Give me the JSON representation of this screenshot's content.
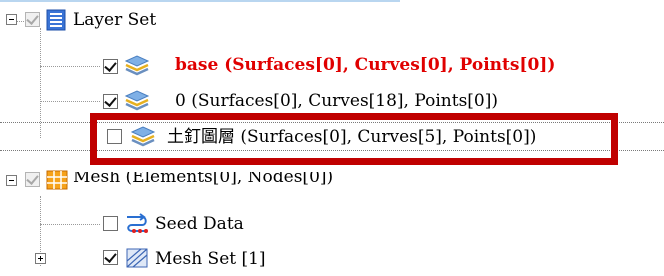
{
  "tree": {
    "layer_set": {
      "label": "Layer Set",
      "icon": "layer-set-icon",
      "checked": true
    },
    "layers": [
      {
        "label": "base (Surfaces[0], Curves[0], Points[0])",
        "checked": true,
        "active": true,
        "icon": "layers-stack-icon"
      },
      {
        "label": "0 (Surfaces[0], Curves[18], Points[0])",
        "checked": true,
        "active": false,
        "icon": "layers-stack-icon"
      },
      {
        "label": "土釘圖層 (Surfaces[0], Curves[5], Points[0])",
        "checked": false,
        "active": false,
        "icon": "layers-stack-icon"
      }
    ],
    "mesh": {
      "label": "Mesh (Elements[0], Nodes[0])",
      "icon": "mesh-grid-icon",
      "checked": true
    },
    "seed_data": {
      "label": "Seed Data",
      "icon": "seed-data-icon",
      "checked": false
    },
    "mesh_set": {
      "label": "Mesh Set [1]",
      "icon": "mesh-set-icon",
      "checked": true
    }
  },
  "colors": {
    "active_layer": "#e00000",
    "highlight_border": "#c00000"
  }
}
